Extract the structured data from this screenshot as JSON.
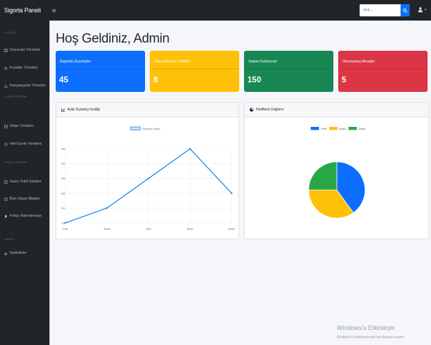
{
  "topbar": {
    "brand": "Sigorta Paneli",
    "menu_icon": "hamburger-icon",
    "search_placeholder": "Ara...",
    "search_icon": "search-icon",
    "user_icon": "user-icon"
  },
  "sidebar": {
    "sections": [
      {
        "heading": "YÖNETİM",
        "items": [
          {
            "label": "Duyurular Yönetimi",
            "icon": "list-icon"
          },
          {
            "label": "Fırsatlar Yönetimi",
            "icon": "percent-icon"
          },
          {
            "label": "Kampanyalar Yönetimi",
            "icon": "warning-icon"
          }
        ]
      },
      {
        "heading": "İÇERİK YÖNETİMİ",
        "items": [
          {
            "label": "Slider Yönetimi",
            "icon": "image-icon"
          },
          {
            "label": "Html İçerik Yönetimi",
            "icon": "info-icon"
          }
        ]
      },
      {
        "heading": "TEKLİF YÖNETİMİ",
        "items": [
          {
            "label": "Gelen Teklif İstekleri",
            "icon": "inbox-icon"
          },
          {
            "label": "Bize Ulaşın Bilgileri",
            "icon": "mail-icon"
          },
          {
            "label": "Poliçe Hatırlatmaları",
            "icon": "bell-icon"
          }
        ]
      },
      {
        "heading": "ANALİZ",
        "items": [
          {
            "label": "İstatistikler",
            "icon": "chart-icon"
          }
        ]
      }
    ]
  },
  "main": {
    "title": "Hoş Geldiniz, Admin",
    "cards": [
      {
        "label": "Bugünkü Ziyaretçiler",
        "value": "45",
        "color": "#0d6efd"
      },
      {
        "label": "Onay Bekleyen Teklifler",
        "value": "8",
        "color": "#ffc107"
      },
      {
        "label": "Toplam Kullanıcılar",
        "value": "150",
        "color": "#198754"
      },
      {
        "label": "Okunmamış Mesajlar",
        "value": "5",
        "color": "#dc3545"
      }
    ],
    "line_panel_title": "Aylık Ziyaretçi Grafiği",
    "line_panel_icon": "line-chart-icon",
    "pie_panel_title": "Tekliflerin Dağılımı",
    "pie_panel_icon": "pie-chart-icon"
  },
  "watermark": {
    "title": "Windows'u Etkinleştir",
    "subtitle": "Windows'u etkinleştirmek için Ayarlar'a gidin."
  },
  "chart_data": [
    {
      "type": "line",
      "x": [
        "Ocak",
        "Şubat",
        "Mart",
        "Nisan",
        "Mayıs"
      ],
      "series": [
        {
          "name": "Ziyaretçi Sayısı",
          "values": [
            150,
            200,
            300,
            400,
            250
          ],
          "color": "#1e88e5"
        }
      ],
      "ylim": [
        150,
        400
      ],
      "yticks": [
        150,
        200,
        250,
        300,
        350,
        400
      ],
      "grid": true,
      "legend": "top-center"
    },
    {
      "type": "pie",
      "categories": [
        "Trafik",
        "Kasko",
        "Sağlık"
      ],
      "values": [
        40,
        35,
        25
      ],
      "colors": [
        "#0d6efd",
        "#ffc107",
        "#28a745"
      ],
      "legend": "top-center"
    }
  ]
}
